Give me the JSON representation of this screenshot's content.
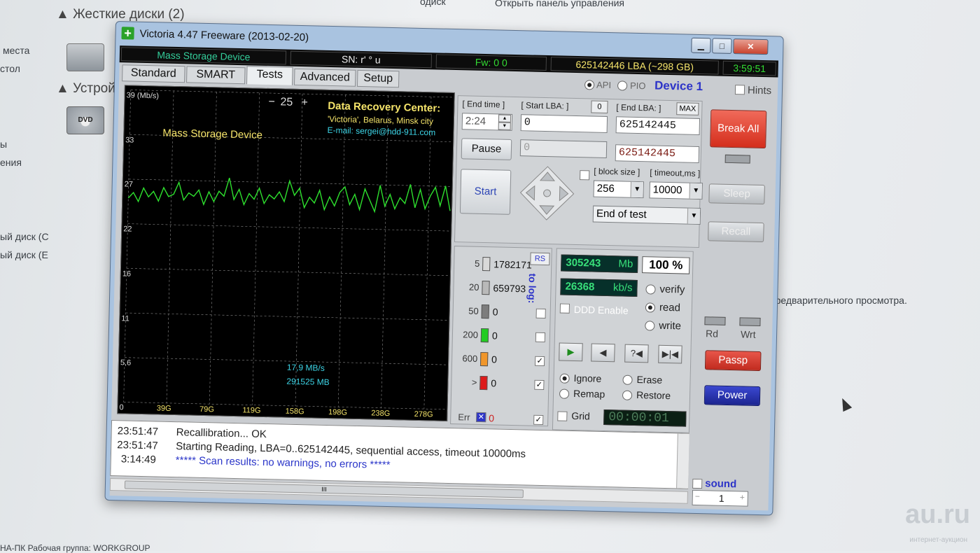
{
  "desktop": {
    "hdd_group": "Жесткие диски (2)",
    "devices_group": "Устрой",
    "top_menu": "Открыть панель управления",
    "top_menu_left": "одиск",
    "left_items": [
      "места",
      "стол",
      "ы",
      "ения",
      "ый диск (C",
      "ый диск (E"
    ],
    "preview_text": "предварительного просмотра.",
    "footer_text": "НА-ПК  Рабочая группа: WORKGROUP",
    "watermark": "au.ru",
    "watermark_sub": "интернет-аукцион",
    "dvd_label": "DVD"
  },
  "window": {
    "title": "Victoria 4.47  Freeware (2013-02-20)",
    "close_glyph": "✕",
    "min_glyph": "▁",
    "max_glyph": "□"
  },
  "infobar": {
    "device": "Mass Storage Device",
    "sn": "SN: r'           ° u",
    "fw": "Fw: 0 0",
    "lba": "625142446 LBA (~298 GB)",
    "time": "3:59:51"
  },
  "tabs": [
    "Standard",
    "SMART",
    "Tests",
    "Advanced",
    "Setup"
  ],
  "mode": {
    "api": "API",
    "pio": "PIO",
    "device": "Device 1",
    "hints": "Hints"
  },
  "chart_data": {
    "type": "line",
    "y_ticks": [
      "39 (Mb/s)",
      "33",
      "27",
      "22",
      "16",
      "11",
      "5,6",
      "0"
    ],
    "x_ticks": [
      "39G",
      "79G",
      "119G",
      "158G",
      "198G",
      "238G",
      "278G"
    ],
    "ylim": [
      0,
      39
    ],
    "zoom_minus": "−",
    "zoom_value": "25",
    "zoom_plus": "+",
    "device_label": "Mass Storage Device",
    "drc_title": "Data Recovery Center:",
    "drc_line1": "'Victoria', Belarus, Minsk city",
    "drc_line2": "E-mail: sergei@hdd-911.com",
    "speed_label": "17,9 MB/s",
    "size_label": "291525 MB",
    "series": [
      {
        "values": [
          25.5,
          26.2,
          25.1,
          26.8,
          25.7,
          26.4,
          25.2,
          26.9,
          25.8,
          26.1,
          27.6,
          25.4,
          26.3,
          25.9,
          26.7,
          24.9,
          26.5,
          25.3,
          26.6,
          26.0,
          28.3,
          25.6,
          26.9,
          25.0,
          26.4,
          25.7,
          27.1,
          25.2,
          26.3,
          25.8,
          26.7,
          25.5,
          28.1,
          26.3,
          27.2,
          24.8,
          26.1,
          25.4,
          27.0,
          24.6,
          26.2,
          25.1,
          26.8,
          27.5,
          25.3,
          26.6,
          24.7,
          27.3,
          25.9,
          24.5,
          27.8,
          25.2,
          26.7,
          24.9,
          26.3,
          25.6,
          28.0,
          25.1,
          27.4,
          25.0,
          26.6,
          27.7,
          25.4,
          27.9,
          24.8
        ]
      }
    ]
  },
  "controls": {
    "end_time_label": "[ End time ]",
    "end_time": "2:24",
    "start_lba_label": "[ Start LBA: ]",
    "start_lba_zero": "0",
    "start_lba": "0",
    "end_lba_label": "[ End LBA: ]",
    "max_label": "MAX",
    "end_lba": "625142445",
    "pause_label": "Pause",
    "current_lba": "0",
    "current_end_lba": "625142445",
    "start_label": "Start",
    "block_size_label": "[ block size ]",
    "block_size": "256",
    "timeout_label": "[ timeout,ms ]",
    "timeout": "10000",
    "end_action": "End of test",
    "arrow_glyph": "▼"
  },
  "blocks": {
    "rs_label": "RS",
    "to_log_label": "to log:",
    "rows": [
      {
        "ms": "5",
        "count": "1782171",
        "color": "#d9d9d9"
      },
      {
        "ms": "20",
        "count": "659793",
        "color": "#b9b9b9"
      },
      {
        "ms": "50",
        "count": "0",
        "color": "#7d7d7d"
      },
      {
        "ms": "200",
        "count": "0",
        "color": "#22cc22"
      },
      {
        "ms": "600",
        "count": "0",
        "color": "#f0962a"
      },
      {
        "ms": ">",
        "count": "0",
        "color": "#dd1a1a"
      }
    ],
    "err_label": "Err",
    "err_count": "0",
    "err_glyph": "✕",
    "check_glyph": "✓"
  },
  "readout": {
    "mb_value": "305243",
    "mb_unit": "Mb",
    "percent": "100  %",
    "speed_value": "26368",
    "speed_unit": "kb/s",
    "verify": "verify",
    "read": "read",
    "write": "write",
    "ddd_label": "DDD Enable",
    "ignore": "Ignore",
    "erase": "Erase",
    "remap": "Remap",
    "restore": "Restore",
    "grid_label": "Grid",
    "timer": "00:00:01",
    "play_glyph": "▶",
    "rewind_glyph": "◀",
    "skip_glyph": "?◀",
    "end_glyph": "▶|◀"
  },
  "right_panel": {
    "break_all": "Break All",
    "sleep": "Sleep",
    "recall": "Recall",
    "rd": "Rd",
    "wrt": "Wrt",
    "passp": "Passp",
    "power": "Power",
    "sound": "sound",
    "sound_value": "1",
    "spin_minus": "−",
    "spin_plus": "+"
  },
  "log": [
    {
      "time": "23:51:47",
      "text": "Recallibration... OK",
      "blue": false
    },
    {
      "time": "23:51:47",
      "text": "Starting Reading, LBA=0..625142445, sequential access, timeout 10000ms",
      "blue": false
    },
    {
      "time": "3:14:49",
      "text": "***** Scan results: no warnings, no errors *****",
      "blue": true
    }
  ],
  "scroll_grip": "III"
}
